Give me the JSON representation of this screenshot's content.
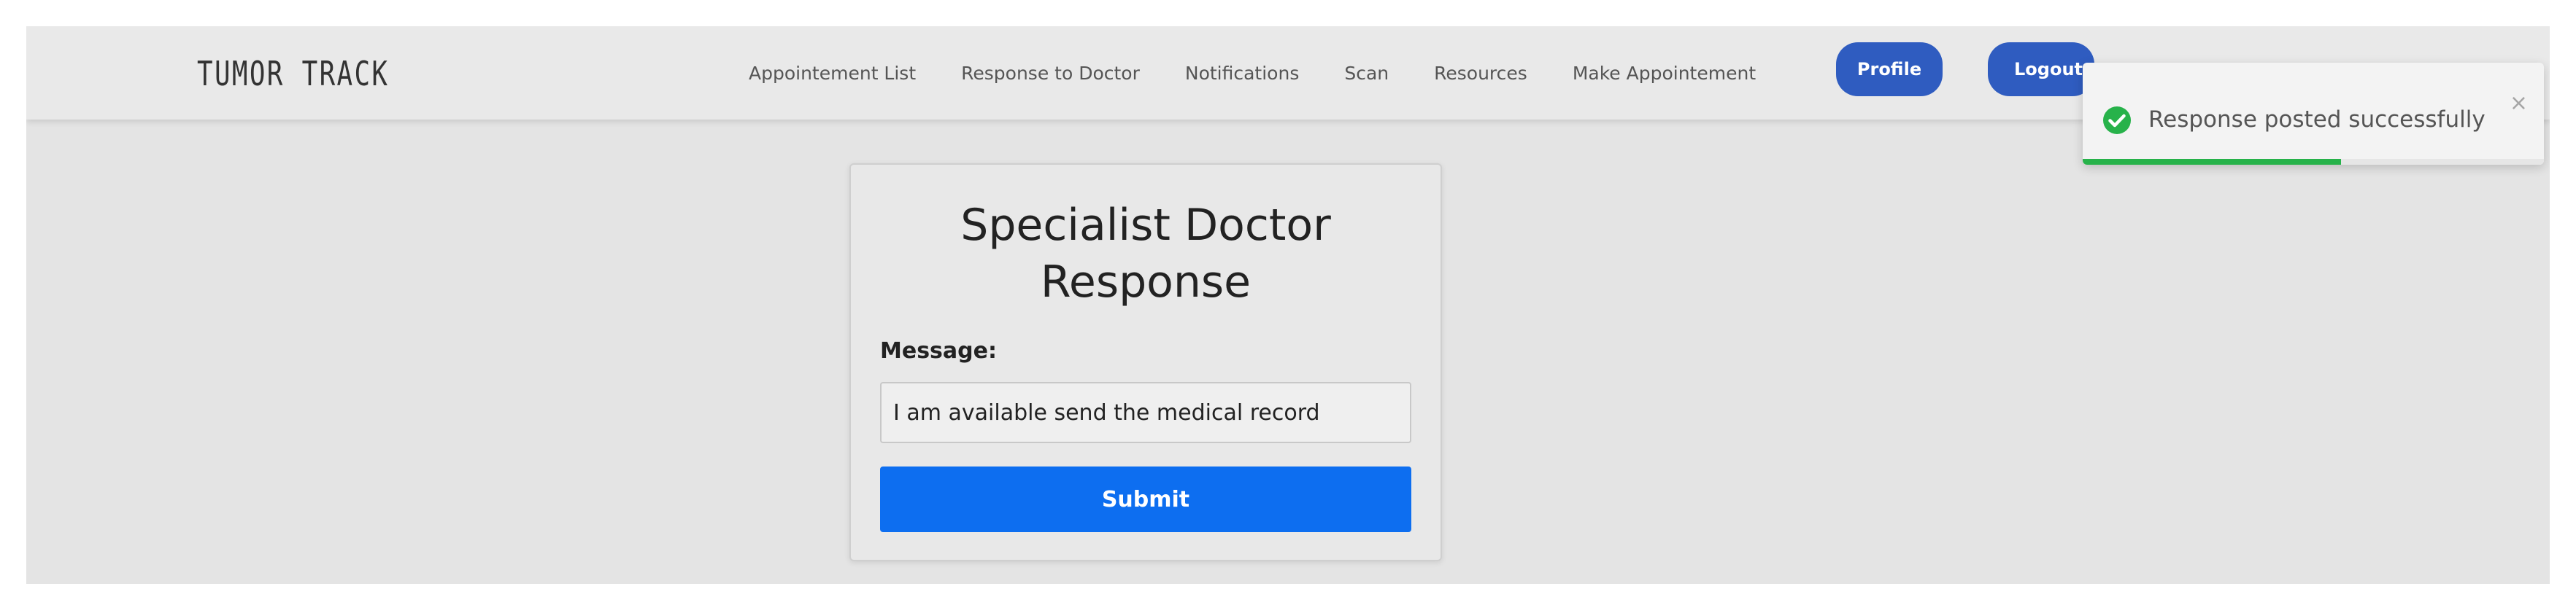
{
  "brand": "TUMOR TRACK",
  "nav": {
    "links": [
      "Appointement List",
      "Response to Doctor",
      "Notifications",
      "Scan",
      "Resources",
      "Make Appointement"
    ],
    "profile_label": "Profile",
    "logout_label": "Logout"
  },
  "form": {
    "title_line1": "Specialist Doctor",
    "title_line2": "Response",
    "message_label": "Message:",
    "message_value": "I am available send the medical record",
    "submit_label": "Submit"
  },
  "toast": {
    "message": "Response posted successfully",
    "close_symbol": "×",
    "icon": "check-circle-icon",
    "progress_fraction": 0.56,
    "status_color": "#27b24a"
  },
  "colors": {
    "primary_button": "#0d6ef0",
    "nav_button": "#2f5cc0",
    "background": "#e4e4e4"
  }
}
